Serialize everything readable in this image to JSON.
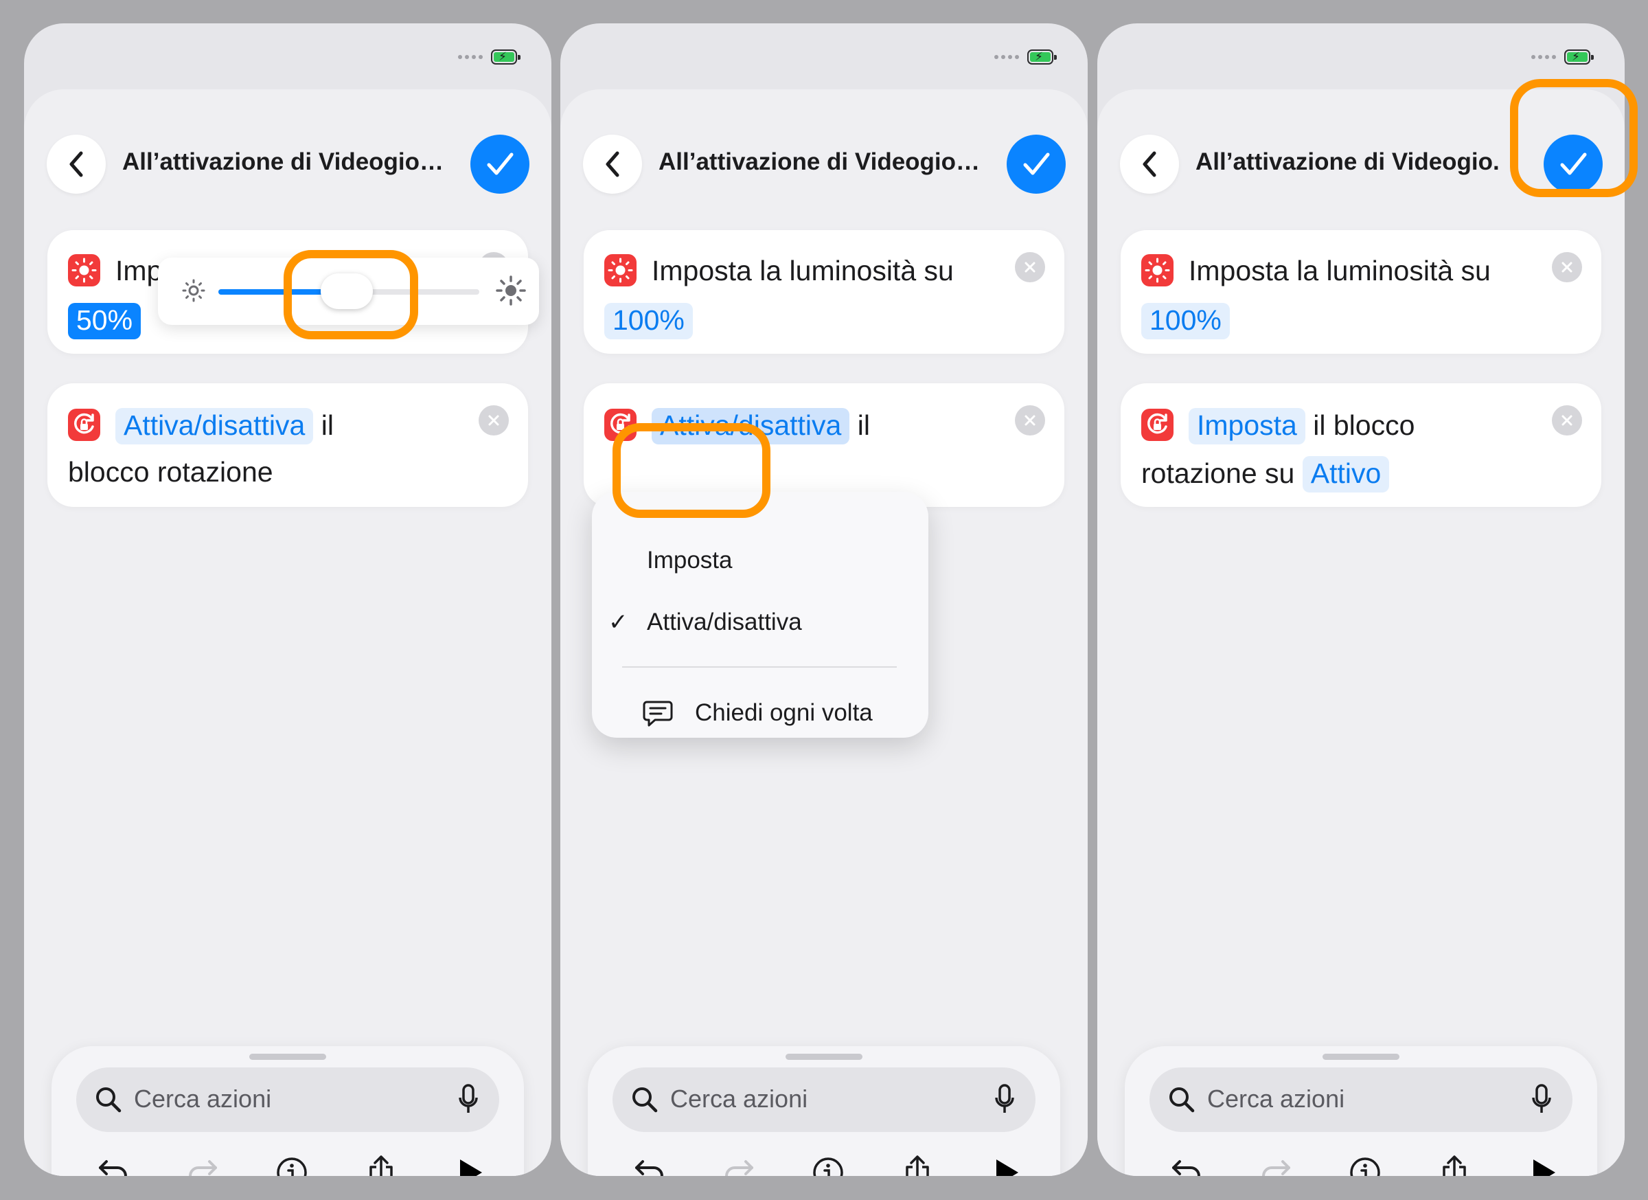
{
  "status_bar": {
    "battery": "charging",
    "cellular": "no-signal-dots"
  },
  "header": {
    "title": "All’attivazione di Videogio…"
  },
  "header_panel3": {
    "title": "All’attivazione di Videogio."
  },
  "brightness_action": {
    "label": "Imposta la luminosità su",
    "value_panel1": "50%",
    "value_panel23": "100%",
    "slider_level": 0.5
  },
  "rotation_action_panel12": {
    "token": "Attiva/disattiva",
    "text_a": "il",
    "text_b": "blocco rotazione"
  },
  "rotation_action_panel3": {
    "token": "Imposta",
    "text_a": "il blocco",
    "text_b": "rotazione su",
    "state_token": "Attivo"
  },
  "menu": {
    "items": [
      {
        "label": "Imposta",
        "checked": false
      },
      {
        "label": "Attiva/disattiva",
        "checked": true
      },
      {
        "label": "Chiedi ogni volta",
        "icon": "speech-bubble-icon"
      }
    ],
    "checkmark": "✓"
  },
  "toolbar": {
    "search_placeholder": "Cerca azioni",
    "icons": [
      "undo-icon",
      "redo-icon",
      "info-icon",
      "share-icon",
      "play-icon"
    ]
  },
  "colors": {
    "accent": "#0a84ff",
    "highlight": "#ff9500",
    "app_icon": "#f23a3a"
  }
}
